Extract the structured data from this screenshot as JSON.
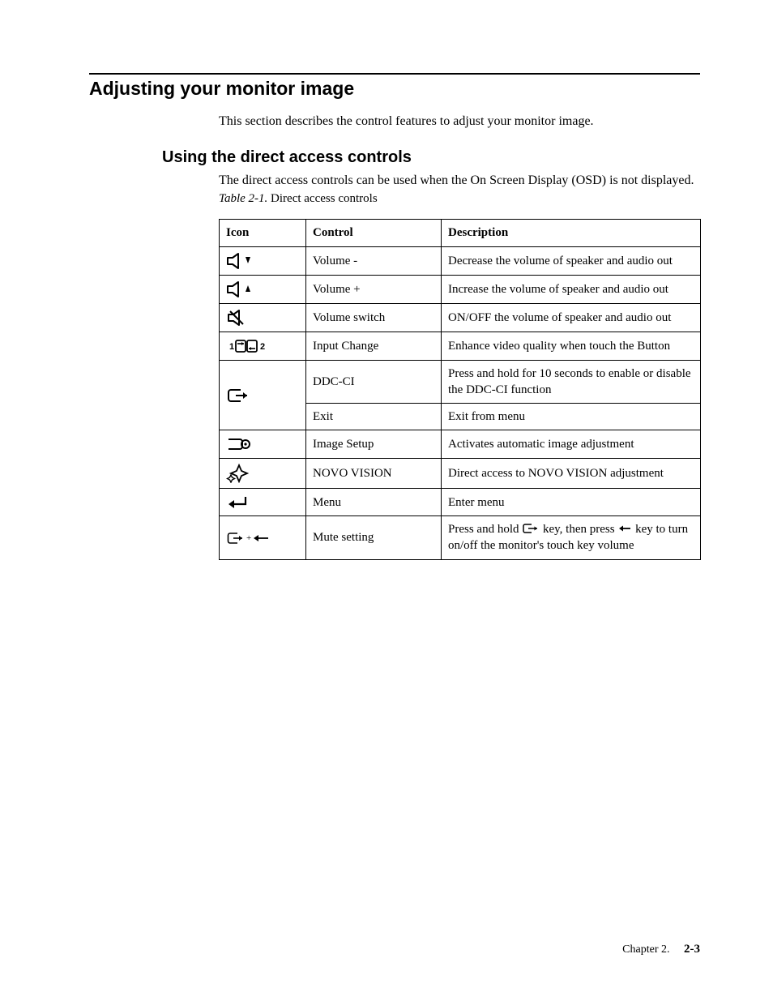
{
  "section": {
    "title": "Adjusting your monitor image",
    "intro": "This section describes the control features to adjust your monitor image."
  },
  "subsection": {
    "title": "Using the direct access controls",
    "intro": "The direct access controls can be used when the On Screen Display (OSD) is not displayed."
  },
  "table": {
    "caption_label": "Table 2-1.",
    "caption_text": "Direct access controls",
    "headers": {
      "icon": "Icon",
      "control": "Control",
      "description": "Description"
    }
  },
  "rows": {
    "r0": {
      "control": "Volume -",
      "description": "Decrease the volume of speaker and audio out"
    },
    "r1": {
      "control": "Volume +",
      "description": "Increase the volume of speaker and audio out"
    },
    "r2": {
      "control": "Volume switch",
      "description": "ON/OFF the volume of speaker and audio out"
    },
    "r3": {
      "control": "Input Change",
      "description": "Enhance video quality when touch the Button"
    },
    "r4": {
      "control": "DDC-CI",
      "description": "Press and hold for 10 seconds to enable or disable the DDC-CI function"
    },
    "r5": {
      "control": "Exit",
      "description": "Exit from menu"
    },
    "r6": {
      "control": "Image Setup",
      "description": "Activates automatic image adjustment"
    },
    "r7": {
      "control": "NOVO VISION",
      "description": "Direct access to NOVO VISION adjustment"
    },
    "r8": {
      "control": "Menu",
      "description": "Enter menu"
    },
    "r9": {
      "control": "Mute setting",
      "desc_pre": "Press and hold ",
      "desc_mid": " key, then press ",
      "desc_post": " key to turn on/off the monitor's touch key volume"
    }
  },
  "footer": {
    "chapter": "Chapter 2.",
    "page": "2-3"
  }
}
